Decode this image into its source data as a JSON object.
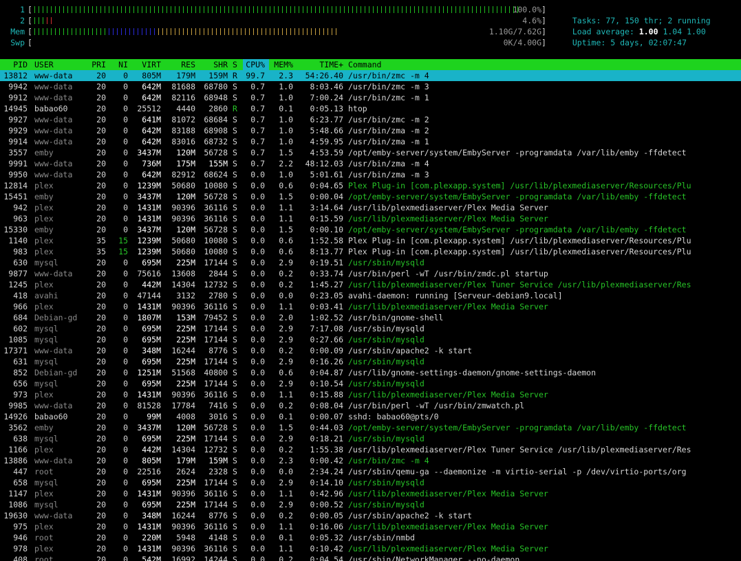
{
  "meters": [
    {
      "label": "1",
      "value": "100.0%",
      "pipes": 118,
      "colors": {
        "green": 118,
        "red": 0,
        "blue": 0,
        "orange": 0
      }
    },
    {
      "label": "2",
      "value": "4.6%",
      "pipes": 5,
      "colors": {
        "green": 3,
        "red": 2,
        "blue": 0,
        "orange": 0
      }
    },
    {
      "label": "Mem",
      "value": "1.10G/7.62G",
      "pipes": 74,
      "colors": {
        "green": 18,
        "blue": 12,
        "orange": 44
      }
    },
    {
      "label": "Swp",
      "value": "0K/4.00G",
      "pipes": 0,
      "colors": {}
    }
  ],
  "summary": {
    "tasks_label": "Tasks: ",
    "tasks_value": "77, 150 thr; 2 running",
    "load_label": "Load average: ",
    "load_1": "1.00",
    "load_5": "1.04",
    "load_15": "1.00",
    "uptime_label": "Uptime: ",
    "uptime_value": "5 days, 02:07:47"
  },
  "columns": [
    "PID",
    "USER",
    "PRI",
    "NI",
    "VIRT",
    "RES",
    "SHR",
    "S",
    "CPU%",
    "MEM%",
    "TIME+",
    "Command"
  ],
  "sort_column": "CPU%",
  "colors": {
    "header_bg": "#1ed31e",
    "selected_bg": "#19b3c8",
    "thread_cmd": "#27c427",
    "meter_label": "#1fb8b8"
  },
  "rows": [
    {
      "pid": "13812",
      "user": "www-data",
      "pri": "20",
      "ni": "0",
      "virt": "805M",
      "res": "179M",
      "shr": "159M",
      "s": "R",
      "cpu": "99.7",
      "mem": "2.3",
      "time": "54:26.40",
      "cmd": "/usr/bin/zmc -m 4",
      "selected": true,
      "thread": false
    },
    {
      "pid": "9942",
      "user": "www-data",
      "pri": "20",
      "ni": "0",
      "virt": "642M",
      "res": "81688",
      "shr": "68780",
      "s": "S",
      "cpu": "0.7",
      "mem": "1.0",
      "time": "8:03.46",
      "cmd": "/usr/bin/zmc -m 3",
      "thread": false
    },
    {
      "pid": "9912",
      "user": "www-data",
      "pri": "20",
      "ni": "0",
      "virt": "642M",
      "res": "82116",
      "shr": "68948",
      "s": "S",
      "cpu": "0.7",
      "mem": "1.0",
      "time": "7:00.24",
      "cmd": "/usr/bin/zmc -m 1",
      "thread": false
    },
    {
      "pid": "14945",
      "user": "babao60",
      "pri": "20",
      "ni": "0",
      "virt": "25512",
      "res": "4440",
      "shr": "2860",
      "s": "R",
      "cpu": "0.7",
      "mem": "0.1",
      "time": "0:05.13",
      "cmd": "htop",
      "thread": false
    },
    {
      "pid": "9927",
      "user": "www-data",
      "pri": "20",
      "ni": "0",
      "virt": "641M",
      "res": "81072",
      "shr": "68684",
      "s": "S",
      "cpu": "0.7",
      "mem": "1.0",
      "time": "6:23.77",
      "cmd": "/usr/bin/zmc -m 2",
      "thread": false
    },
    {
      "pid": "9929",
      "user": "www-data",
      "pri": "20",
      "ni": "0",
      "virt": "642M",
      "res": "83188",
      "shr": "68908",
      "s": "S",
      "cpu": "0.7",
      "mem": "1.0",
      "time": "5:48.66",
      "cmd": "/usr/bin/zma -m 2",
      "thread": false
    },
    {
      "pid": "9914",
      "user": "www-data",
      "pri": "20",
      "ni": "0",
      "virt": "642M",
      "res": "83016",
      "shr": "68732",
      "s": "S",
      "cpu": "0.7",
      "mem": "1.0",
      "time": "4:59.95",
      "cmd": "/usr/bin/zma -m 1",
      "thread": false
    },
    {
      "pid": "3557",
      "user": "emby",
      "pri": "20",
      "ni": "0",
      "virt": "3437M",
      "res": "120M",
      "shr": "56728",
      "s": "S",
      "cpu": "0.7",
      "mem": "1.5",
      "time": "4:53.59",
      "cmd": "/opt/emby-server/system/EmbyServer -programdata /var/lib/emby -ffdetect",
      "thread": false
    },
    {
      "pid": "9991",
      "user": "www-data",
      "pri": "20",
      "ni": "0",
      "virt": "736M",
      "res": "175M",
      "shr": "155M",
      "s": "S",
      "cpu": "0.7",
      "mem": "2.2",
      "time": "48:12.03",
      "cmd": "/usr/bin/zma -m 4",
      "thread": false
    },
    {
      "pid": "9950",
      "user": "www-data",
      "pri": "20",
      "ni": "0",
      "virt": "642M",
      "res": "82912",
      "shr": "68624",
      "s": "S",
      "cpu": "0.0",
      "mem": "1.0",
      "time": "5:01.61",
      "cmd": "/usr/bin/zma -m 3",
      "thread": false
    },
    {
      "pid": "12814",
      "user": "plex",
      "pri": "20",
      "ni": "0",
      "virt": "1239M",
      "res": "50680",
      "shr": "10080",
      "s": "S",
      "cpu": "0.0",
      "mem": "0.6",
      "time": "0:04.65",
      "cmd": "Plex Plug-in [com.plexapp.system] /usr/lib/plexmediaserver/Resources/Plu",
      "thread": true
    },
    {
      "pid": "15451",
      "user": "emby",
      "pri": "20",
      "ni": "0",
      "virt": "3437M",
      "res": "120M",
      "shr": "56728",
      "s": "S",
      "cpu": "0.0",
      "mem": "1.5",
      "time": "0:00.04",
      "cmd": "/opt/emby-server/system/EmbyServer -programdata /var/lib/emby -ffdetect",
      "thread": true
    },
    {
      "pid": "942",
      "user": "plex",
      "pri": "20",
      "ni": "0",
      "virt": "1431M",
      "res": "90396",
      "shr": "36116",
      "s": "S",
      "cpu": "0.0",
      "mem": "1.1",
      "time": "3:14.64",
      "cmd": "/usr/lib/plexmediaserver/Plex Media Server",
      "thread": false
    },
    {
      "pid": "963",
      "user": "plex",
      "pri": "20",
      "ni": "0",
      "virt": "1431M",
      "res": "90396",
      "shr": "36116",
      "s": "S",
      "cpu": "0.0",
      "mem": "1.1",
      "time": "0:15.59",
      "cmd": "/usr/lib/plexmediaserver/Plex Media Server",
      "thread": true
    },
    {
      "pid": "15330",
      "user": "emby",
      "pri": "20",
      "ni": "0",
      "virt": "3437M",
      "res": "120M",
      "shr": "56728",
      "s": "S",
      "cpu": "0.0",
      "mem": "1.5",
      "time": "0:00.10",
      "cmd": "/opt/emby-server/system/EmbyServer -programdata /var/lib/emby -ffdetect",
      "thread": true
    },
    {
      "pid": "1140",
      "user": "plex",
      "pri": "35",
      "ni": "15",
      "virt": "1239M",
      "res": "50680",
      "shr": "10080",
      "s": "S",
      "cpu": "0.0",
      "mem": "0.6",
      "time": "1:52.58",
      "cmd": "Plex Plug-in [com.plexapp.system] /usr/lib/plexmediaserver/Resources/Plu",
      "thread": false
    },
    {
      "pid": "983",
      "user": "plex",
      "pri": "35",
      "ni": "15",
      "virt": "1239M",
      "res": "50680",
      "shr": "10080",
      "s": "S",
      "cpu": "0.0",
      "mem": "0.6",
      "time": "8:13.77",
      "cmd": "Plex Plug-in [com.plexapp.system] /usr/lib/plexmediaserver/Resources/Plu",
      "thread": false
    },
    {
      "pid": "630",
      "user": "mysql",
      "pri": "20",
      "ni": "0",
      "virt": "695M",
      "res": "225M",
      "shr": "17144",
      "s": "S",
      "cpu": "0.0",
      "mem": "2.9",
      "time": "0:19.51",
      "cmd": "/usr/sbin/mysqld",
      "thread": true
    },
    {
      "pid": "9877",
      "user": "www-data",
      "pri": "20",
      "ni": "0",
      "virt": "75616",
      "res": "13608",
      "shr": "2844",
      "s": "S",
      "cpu": "0.0",
      "mem": "0.2",
      "time": "0:33.74",
      "cmd": "/usr/bin/perl -wT /usr/bin/zmdc.pl startup",
      "thread": false
    },
    {
      "pid": "1245",
      "user": "plex",
      "pri": "20",
      "ni": "0",
      "virt": "442M",
      "res": "14304",
      "shr": "12732",
      "s": "S",
      "cpu": "0.0",
      "mem": "0.2",
      "time": "1:45.27",
      "cmd": "/usr/lib/plexmediaserver/Plex Tuner Service /usr/lib/plexmediaserver/Res",
      "thread": true
    },
    {
      "pid": "418",
      "user": "avahi",
      "pri": "20",
      "ni": "0",
      "virt": "47144",
      "res": "3132",
      "shr": "2780",
      "s": "S",
      "cpu": "0.0",
      "mem": "0.0",
      "time": "0:23.05",
      "cmd": "avahi-daemon: running [Serveur-debian9.local]",
      "thread": false
    },
    {
      "pid": "966",
      "user": "plex",
      "pri": "20",
      "ni": "0",
      "virt": "1431M",
      "res": "90396",
      "shr": "36116",
      "s": "S",
      "cpu": "0.0",
      "mem": "1.1",
      "time": "0:03.41",
      "cmd": "/usr/lib/plexmediaserver/Plex Media Server",
      "thread": true
    },
    {
      "pid": "684",
      "user": "Debian-gd",
      "pri": "20",
      "ni": "0",
      "virt": "1807M",
      "res": "153M",
      "shr": "79452",
      "s": "S",
      "cpu": "0.0",
      "mem": "2.0",
      "time": "1:02.52",
      "cmd": "/usr/bin/gnome-shell",
      "thread": false
    },
    {
      "pid": "602",
      "user": "mysql",
      "pri": "20",
      "ni": "0",
      "virt": "695M",
      "res": "225M",
      "shr": "17144",
      "s": "S",
      "cpu": "0.0",
      "mem": "2.9",
      "time": "7:17.08",
      "cmd": "/usr/sbin/mysqld",
      "thread": false
    },
    {
      "pid": "1085",
      "user": "mysql",
      "pri": "20",
      "ni": "0",
      "virt": "695M",
      "res": "225M",
      "shr": "17144",
      "s": "S",
      "cpu": "0.0",
      "mem": "2.9",
      "time": "0:27.66",
      "cmd": "/usr/sbin/mysqld",
      "thread": true
    },
    {
      "pid": "17371",
      "user": "www-data",
      "pri": "20",
      "ni": "0",
      "virt": "348M",
      "res": "16244",
      "shr": "8776",
      "s": "S",
      "cpu": "0.0",
      "mem": "0.2",
      "time": "0:00.09",
      "cmd": "/usr/sbin/apache2 -k start",
      "thread": false
    },
    {
      "pid": "631",
      "user": "mysql",
      "pri": "20",
      "ni": "0",
      "virt": "695M",
      "res": "225M",
      "shr": "17144",
      "s": "S",
      "cpu": "0.0",
      "mem": "2.9",
      "time": "0:16.26",
      "cmd": "/usr/sbin/mysqld",
      "thread": true
    },
    {
      "pid": "852",
      "user": "Debian-gd",
      "pri": "20",
      "ni": "0",
      "virt": "1251M",
      "res": "51568",
      "shr": "40800",
      "s": "S",
      "cpu": "0.0",
      "mem": "0.6",
      "time": "0:04.87",
      "cmd": "/usr/lib/gnome-settings-daemon/gnome-settings-daemon",
      "thread": false
    },
    {
      "pid": "656",
      "user": "mysql",
      "pri": "20",
      "ni": "0",
      "virt": "695M",
      "res": "225M",
      "shr": "17144",
      "s": "S",
      "cpu": "0.0",
      "mem": "2.9",
      "time": "0:10.54",
      "cmd": "/usr/sbin/mysqld",
      "thread": true
    },
    {
      "pid": "973",
      "user": "plex",
      "pri": "20",
      "ni": "0",
      "virt": "1431M",
      "res": "90396",
      "shr": "36116",
      "s": "S",
      "cpu": "0.0",
      "mem": "1.1",
      "time": "0:15.88",
      "cmd": "/usr/lib/plexmediaserver/Plex Media Server",
      "thread": true
    },
    {
      "pid": "9985",
      "user": "www-data",
      "pri": "20",
      "ni": "0",
      "virt": "81528",
      "res": "17784",
      "shr": "7416",
      "s": "S",
      "cpu": "0.0",
      "mem": "0.2",
      "time": "0:08.04",
      "cmd": "/usr/bin/perl -wT /usr/bin/zmwatch.pl",
      "thread": false
    },
    {
      "pid": "14926",
      "user": "babao60",
      "pri": "20",
      "ni": "0",
      "virt": "99M",
      "res": "4008",
      "shr": "3016",
      "s": "S",
      "cpu": "0.0",
      "mem": "0.1",
      "time": "0:00.07",
      "cmd": "sshd: babao60@pts/0",
      "thread": false
    },
    {
      "pid": "3562",
      "user": "emby",
      "pri": "20",
      "ni": "0",
      "virt": "3437M",
      "res": "120M",
      "shr": "56728",
      "s": "S",
      "cpu": "0.0",
      "mem": "1.5",
      "time": "0:44.03",
      "cmd": "/opt/emby-server/system/EmbyServer -programdata /var/lib/emby -ffdetect",
      "thread": true
    },
    {
      "pid": "638",
      "user": "mysql",
      "pri": "20",
      "ni": "0",
      "virt": "695M",
      "res": "225M",
      "shr": "17144",
      "s": "S",
      "cpu": "0.0",
      "mem": "2.9",
      "time": "0:18.21",
      "cmd": "/usr/sbin/mysqld",
      "thread": true
    },
    {
      "pid": "1166",
      "user": "plex",
      "pri": "20",
      "ni": "0",
      "virt": "442M",
      "res": "14304",
      "shr": "12732",
      "s": "S",
      "cpu": "0.0",
      "mem": "0.2",
      "time": "1:55.38",
      "cmd": "/usr/lib/plexmediaserver/Plex Tuner Service /usr/lib/plexmediaserver/Res",
      "thread": false
    },
    {
      "pid": "13886",
      "user": "www-data",
      "pri": "20",
      "ni": "0",
      "virt": "805M",
      "res": "179M",
      "shr": "159M",
      "s": "S",
      "cpu": "0.0",
      "mem": "2.3",
      "time": "0:00.42",
      "cmd": "/usr/bin/zmc -m 4",
      "thread": true
    },
    {
      "pid": "447",
      "user": "root",
      "pri": "20",
      "ni": "0",
      "virt": "22516",
      "res": "2624",
      "shr": "2328",
      "s": "S",
      "cpu": "0.0",
      "mem": "0.0",
      "time": "2:34.24",
      "cmd": "/usr/sbin/qemu-ga --daemonize -m virtio-serial -p /dev/virtio-ports/org",
      "thread": false
    },
    {
      "pid": "658",
      "user": "mysql",
      "pri": "20",
      "ni": "0",
      "virt": "695M",
      "res": "225M",
      "shr": "17144",
      "s": "S",
      "cpu": "0.0",
      "mem": "2.9",
      "time": "0:14.10",
      "cmd": "/usr/sbin/mysqld",
      "thread": true
    },
    {
      "pid": "1147",
      "user": "plex",
      "pri": "20",
      "ni": "0",
      "virt": "1431M",
      "res": "90396",
      "shr": "36116",
      "s": "S",
      "cpu": "0.0",
      "mem": "1.1",
      "time": "0:42.96",
      "cmd": "/usr/lib/plexmediaserver/Plex Media Server",
      "thread": true
    },
    {
      "pid": "1086",
      "user": "mysql",
      "pri": "20",
      "ni": "0",
      "virt": "695M",
      "res": "225M",
      "shr": "17144",
      "s": "S",
      "cpu": "0.0",
      "mem": "2.9",
      "time": "0:00.52",
      "cmd": "/usr/sbin/mysqld",
      "thread": true
    },
    {
      "pid": "19630",
      "user": "www-data",
      "pri": "20",
      "ni": "0",
      "virt": "348M",
      "res": "16244",
      "shr": "8776",
      "s": "S",
      "cpu": "0.0",
      "mem": "0.2",
      "time": "0:00.05",
      "cmd": "/usr/sbin/apache2 -k start",
      "thread": false
    },
    {
      "pid": "975",
      "user": "plex",
      "pri": "20",
      "ni": "0",
      "virt": "1431M",
      "res": "90396",
      "shr": "36116",
      "s": "S",
      "cpu": "0.0",
      "mem": "1.1",
      "time": "0:16.06",
      "cmd": "/usr/lib/plexmediaserver/Plex Media Server",
      "thread": true
    },
    {
      "pid": "946",
      "user": "root",
      "pri": "20",
      "ni": "0",
      "virt": "220M",
      "res": "5948",
      "shr": "4148",
      "s": "S",
      "cpu": "0.0",
      "mem": "0.1",
      "time": "0:05.32",
      "cmd": "/usr/sbin/nmbd",
      "thread": false
    },
    {
      "pid": "978",
      "user": "plex",
      "pri": "20",
      "ni": "0",
      "virt": "1431M",
      "res": "90396",
      "shr": "36116",
      "s": "S",
      "cpu": "0.0",
      "mem": "1.1",
      "time": "0:10.42",
      "cmd": "/usr/lib/plexmediaserver/Plex Media Server",
      "thread": true
    },
    {
      "pid": "408",
      "user": "root",
      "pri": "20",
      "ni": "0",
      "virt": "542M",
      "res": "16992",
      "shr": "14244",
      "s": "S",
      "cpu": "0.0",
      "mem": "0.2",
      "time": "0:04.54",
      "cmd": "/usr/sbin/NetworkManager --no-daemon",
      "thread": false
    }
  ]
}
